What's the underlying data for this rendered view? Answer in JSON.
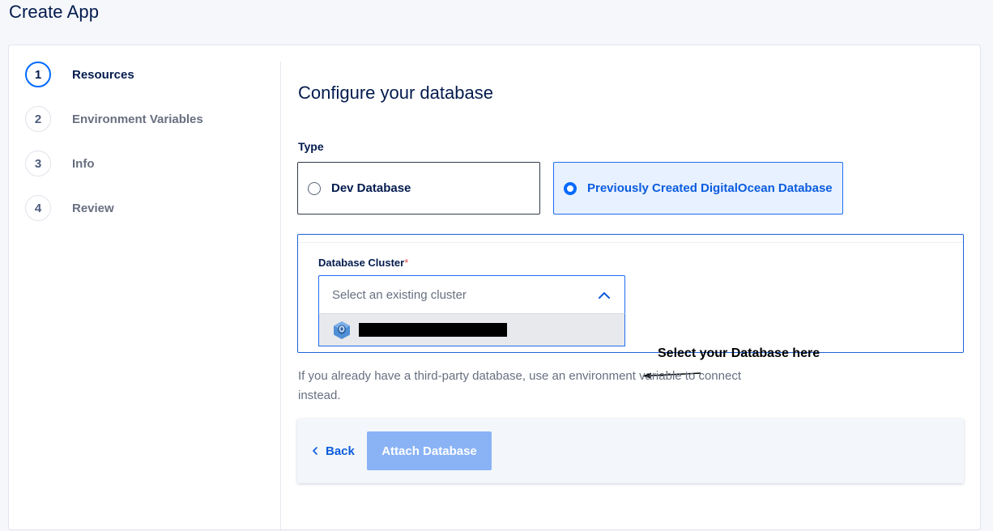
{
  "page": {
    "title": "Create App"
  },
  "steps": [
    {
      "number": "1",
      "label": "Resources",
      "active": true
    },
    {
      "number": "2",
      "label": "Environment Variables",
      "active": false
    },
    {
      "number": "3",
      "label": "Info",
      "active": false
    },
    {
      "number": "4",
      "label": "Review",
      "active": false
    }
  ],
  "main": {
    "title": "Configure your database",
    "type_label": "Type",
    "options": [
      {
        "label": "Dev Database",
        "selected": false
      },
      {
        "label": "Previously Created DigitalOcean Database",
        "selected": true
      }
    ],
    "cluster": {
      "label": "Database Cluster",
      "required_mark": "*",
      "placeholder": "Select an existing cluster",
      "dropdown_icon": "chevron-up-icon",
      "option_icon": "postgresql-icon"
    },
    "annotation": "Select your Database here",
    "help_text": "If you already have a third-party database, use an environment variable to connect instead."
  },
  "footer": {
    "back_label": "Back",
    "attach_label": "Attach Database"
  },
  "colors": {
    "accent": "#0069ff",
    "selected_bg": "#e8f1ff",
    "disabled_button": "#8ab3f6"
  }
}
